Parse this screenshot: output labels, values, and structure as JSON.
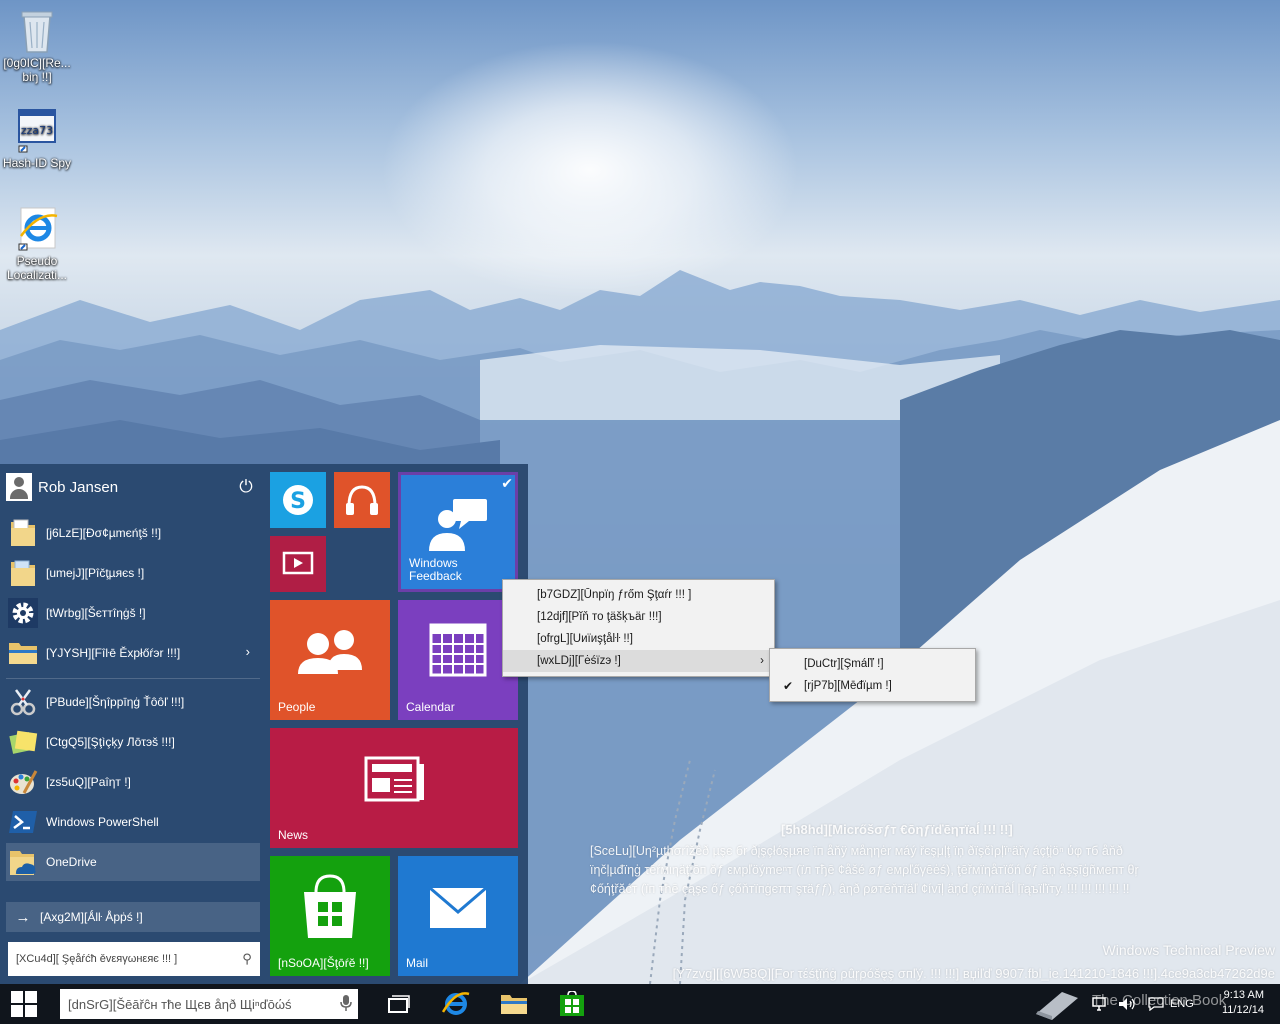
{
  "desktop": {
    "icons": [
      {
        "label": "[0g0IC][Re... biŋ !!]",
        "icon": "recycle-bin-icon"
      },
      {
        "label": "Hash-ID Spy",
        "icon": "hash-id-spy-icon"
      },
      {
        "label": "Pseudo Localizati...",
        "icon": "internet-explorer-icon"
      }
    ]
  },
  "start_menu": {
    "user_name": "Rob Jansen",
    "power_glyph": "⏻",
    "apps": [
      {
        "label": "[j6LzE][Ðσ¢µmєńţš !!]",
        "icon": "documents-folder-icon"
      },
      {
        "label": "[umejJ][Pîčţµяєѕ !]",
        "icon": "pictures-folder-icon"
      },
      {
        "label": "[tWrbg][Šєттîηġš !]",
        "icon": "settings-gear-icon"
      },
      {
        "label": "[YJYSH][Fîŀē Ěxpłőŕэr !!!]",
        "icon": "file-explorer-icon",
        "has_submenu": true
      },
      {
        "label": "[PBude][Šηîppīηġ Ťôôľ !!!]",
        "icon": "snipping-tool-icon"
      },
      {
        "label": "[CtgQ5][Şţìçķy Лōτэš !!!]",
        "icon": "sticky-notes-icon"
      },
      {
        "label": "[zs5uQ][Paîηт !]",
        "icon": "paint-icon"
      },
      {
        "label": "Windows PowerShell",
        "icon": "powershell-icon"
      },
      {
        "label": "OneDrive",
        "icon": "onedrive-icon"
      }
    ],
    "all_apps": "[Axg2M][Ǻlŀ Åpṗś !]",
    "search_placeholder": "[XCu4d][ Şęåŕćħ ěvεяγωнεяє !!! ]",
    "tiles": {
      "windows_feedback": "Windows Feedback",
      "people": "People",
      "calendar": "Calendar",
      "news": "News",
      "store": "[nSoOA][Šţōŕĕ !!]",
      "mail": "Mail"
    },
    "colors": {
      "background": "#2a486e",
      "skype": "#1ba1e2",
      "music": "#e0532a",
      "video": "#b01e45",
      "feedback": "#2b7fd9",
      "people": "#e0532a",
      "calendar": "#7b3fbf",
      "news": "#b81c45",
      "store": "#14a10e",
      "mail": "#1f79d1"
    }
  },
  "context_menu": {
    "items": [
      {
        "label": "[b7GDZ][Ūnpïŋ ƒrőm Şţαŕr !!! ]"
      },
      {
        "label": "[12djf][Pĭň то ţäšķъäг !!!]"
      },
      {
        "label": "[ofrgL][Uиïиşţåŀŀ !!]"
      },
      {
        "label": "[wxLDj][Γėśïzэ !]",
        "has_submenu": true,
        "highlighted": true
      }
    ],
    "submenu": [
      {
        "label": "[DuCtr][Şmáľľ !]",
        "checked": false
      },
      {
        "label": "[rjP7b][Mēđïµm !]",
        "checked": true
      }
    ],
    "check_glyph": "✔",
    "arrow_glyph": "›"
  },
  "watermark": {
    "confidential": "[5h8hd][Micrőšσƒт €ōηƒïďēηтïаĺ !!! !!]",
    "notice_line1": "[SceLu][Uη²µthσrîžêð µşє бr ðįşçłóşµяе їп åňÿ мåηηėr мáý řєşμļţ їņ ðïşčìρļïⁿäřγ áçţįöⁿ ύφ тб åňð",
    "notice_line2": "ïηčļµđïηġ τēŕмιηäţїōп ŏƒ εмрľöýmеⁿт (їл тђē ¢åšé øƒ eмρľőγēėś), ţēřмïηåтïőń őƒ äņ åşşīġñмепт θŗ",
    "notice_line3": "¢őήţřăćт (їп тħē çąşє őƒ çőňтїпġєπт şτäƒƒ), âηð ρøтēňтїäľ ¢ívīļ äņđ çŕïмїпåĺ ļïąъїľïту. !!! !!! !!! !!! !!",
    "preview": "Windows Technical Preview",
    "build": "[Y7zvg][[6W58Q][For τέśţïńġ ρûŗρóšęş σпľý. !!! !!!] вџіľď 9907.fbl_ie.141210-1846 !!!].4ce9a3cb47262d9e"
  },
  "taskbar": {
    "search_placeholder": "[dnSrG][Šēāřĉн тħе Щєв åηð Щіⁿďōώś",
    "mic_glyph": "🎤",
    "tray_lang": "ENG",
    "time": "9:13 AM",
    "date": "11/12/14",
    "watermark": "The Collection Book"
  }
}
